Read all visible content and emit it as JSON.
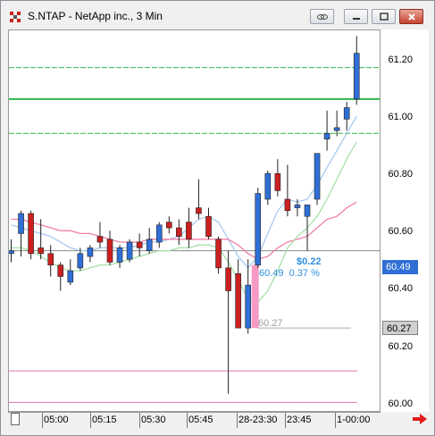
{
  "window": {
    "title": "S.NTAP - NetApp inc., 3 Min"
  },
  "colors": {
    "up": "#2f6fd6",
    "down": "#cc2020",
    "grid_green": "#2db84a",
    "ma_blue": "#a8c8f0",
    "ma_pink": "#f080a8",
    "ma_green": "#a8e0a8",
    "current_tag_bg": "#2f6fd6",
    "cursor_tag_bg": "#d0d0d0",
    "measure_fill": "#f59ac4"
  },
  "icons": [
    "app-chart-icon",
    "link-icon",
    "minimize-icon",
    "maximize-icon",
    "close-icon",
    "scroll-right-arrow-icon"
  ],
  "y_axis": {
    "labels": [
      "61.20",
      "61.00",
      "60.80",
      "60.60",
      "60.40",
      "60.20",
      "60.00"
    ]
  },
  "price_tags": {
    "current": "60.49",
    "cursor": "60.27"
  },
  "x_axis": {
    "labels": [
      "05:00",
      "05:15",
      "05:30",
      "05:45",
      "28-23:30",
      "23:45",
      "1-00:00"
    ]
  },
  "measure": {
    "change": "$0.22",
    "detail": "60.49  0.37 %",
    "base": "60.27"
  },
  "chart_data": {
    "type": "candlestick",
    "ylim": [
      59.98,
      61.31
    ],
    "levels": {
      "green_solid": 61.07,
      "green_dashed": [
        61.18,
        60.95
      ],
      "pink_lines": [
        60.12,
        60.01
      ],
      "gray_lines": [
        60.54,
        60.27
      ]
    },
    "candles": [
      {
        "o": 60.53,
        "h": 60.58,
        "l": 60.5,
        "c": 60.54
      },
      {
        "o": 60.6,
        "h": 60.68,
        "l": 60.52,
        "c": 60.67
      },
      {
        "o": 60.67,
        "h": 60.68,
        "l": 60.51,
        "c": 60.53
      },
      {
        "o": 60.55,
        "h": 60.65,
        "l": 60.51,
        "c": 60.53
      },
      {
        "o": 60.53,
        "h": 60.56,
        "l": 60.45,
        "c": 60.49
      },
      {
        "o": 60.49,
        "h": 60.5,
        "l": 60.4,
        "c": 60.45
      },
      {
        "o": 60.43,
        "h": 60.51,
        "l": 60.42,
        "c": 60.47
      },
      {
        "o": 60.48,
        "h": 60.55,
        "l": 60.47,
        "c": 60.53
      },
      {
        "o": 60.52,
        "h": 60.56,
        "l": 60.5,
        "c": 60.55
      },
      {
        "o": 60.59,
        "h": 60.64,
        "l": 60.55,
        "c": 60.57
      },
      {
        "o": 60.58,
        "h": 60.61,
        "l": 60.49,
        "c": 60.5
      },
      {
        "o": 60.5,
        "h": 60.56,
        "l": 60.48,
        "c": 60.55
      },
      {
        "o": 60.51,
        "h": 60.58,
        "l": 60.5,
        "c": 60.57
      },
      {
        "o": 60.57,
        "h": 60.6,
        "l": 60.52,
        "c": 60.55
      },
      {
        "o": 60.54,
        "h": 60.62,
        "l": 60.53,
        "c": 60.58
      },
      {
        "o": 60.57,
        "h": 60.64,
        "l": 60.55,
        "c": 60.63
      },
      {
        "o": 60.64,
        "h": 60.66,
        "l": 60.6,
        "c": 60.62
      },
      {
        "o": 60.62,
        "h": 60.65,
        "l": 60.56,
        "c": 60.59
      },
      {
        "o": 60.64,
        "h": 60.69,
        "l": 60.55,
        "c": 60.58
      },
      {
        "o": 60.69,
        "h": 60.79,
        "l": 60.65,
        "c": 60.67
      },
      {
        "o": 60.66,
        "h": 60.69,
        "l": 60.58,
        "c": 60.59
      },
      {
        "o": 60.58,
        "h": 60.59,
        "l": 60.46,
        "c": 60.48
      },
      {
        "o": 60.48,
        "h": 60.54,
        "l": 60.04,
        "c": 60.4
      },
      {
        "o": 60.46,
        "h": 60.51,
        "l": 60.29,
        "c": 60.27
      },
      {
        "o": 60.27,
        "h": 60.51,
        "l": 60.25,
        "c": 60.42
      },
      {
        "o": 60.49,
        "h": 60.76,
        "l": 60.48,
        "c": 60.74
      },
      {
        "o": 60.72,
        "h": 60.82,
        "l": 60.7,
        "c": 60.81
      },
      {
        "o": 60.81,
        "h": 60.86,
        "l": 60.73,
        "c": 60.75
      },
      {
        "o": 60.72,
        "h": 60.84,
        "l": 60.66,
        "c": 60.68
      },
      {
        "o": 60.69,
        "h": 60.72,
        "l": 60.66,
        "c": 60.7
      },
      {
        "o": 60.66,
        "h": 60.7,
        "l": 60.54,
        "c": 60.7
      },
      {
        "o": 60.72,
        "h": 60.84,
        "l": 60.7,
        "c": 60.88
      },
      {
        "o": 60.93,
        "h": 61.03,
        "l": 60.89,
        "c": 60.95
      },
      {
        "o": 60.96,
        "h": 61.03,
        "l": 60.94,
        "c": 60.97
      },
      {
        "o": 61.0,
        "h": 61.06,
        "l": 60.96,
        "c": 61.04
      },
      {
        "o": 61.07,
        "h": 61.29,
        "l": 61.05,
        "c": 61.23
      }
    ],
    "moving_averages": [
      {
        "name": "blue",
        "values": [
          60.63,
          60.62,
          60.61,
          60.6,
          60.59,
          60.57,
          60.55,
          60.54,
          60.54,
          60.55,
          60.55,
          60.55,
          60.55,
          60.56,
          60.57,
          60.57,
          60.58,
          60.59,
          60.62,
          60.65,
          60.66,
          60.64,
          60.58,
          60.52,
          60.48,
          60.52,
          60.6,
          60.68,
          60.72,
          60.71,
          60.72,
          60.77,
          60.83,
          60.89,
          60.95,
          61.01
        ]
      },
      {
        "name": "pink",
        "values": [
          60.65,
          60.65,
          60.64,
          60.63,
          60.62,
          60.61,
          60.61,
          60.6,
          60.6,
          60.59,
          60.58,
          60.57,
          60.57,
          60.57,
          60.58,
          60.58,
          60.58,
          60.58,
          60.58,
          60.58,
          60.58,
          60.58,
          60.58,
          60.56,
          60.53,
          60.51,
          60.52,
          60.55,
          60.57,
          60.58,
          60.59,
          60.62,
          60.65,
          60.66,
          60.69,
          60.71
        ]
      },
      {
        "name": "green",
        "values": [
          60.55,
          60.55,
          60.54,
          60.52,
          60.5,
          60.48,
          60.47,
          60.47,
          60.48,
          60.49,
          60.49,
          60.5,
          60.51,
          60.52,
          60.53,
          60.54,
          60.54,
          60.55,
          60.55,
          60.56,
          60.56,
          60.55,
          60.5,
          60.44,
          60.37,
          60.36,
          60.4,
          60.47,
          60.55,
          60.59,
          60.62,
          60.66,
          60.72,
          60.79,
          60.86,
          60.92
        ]
      }
    ]
  }
}
